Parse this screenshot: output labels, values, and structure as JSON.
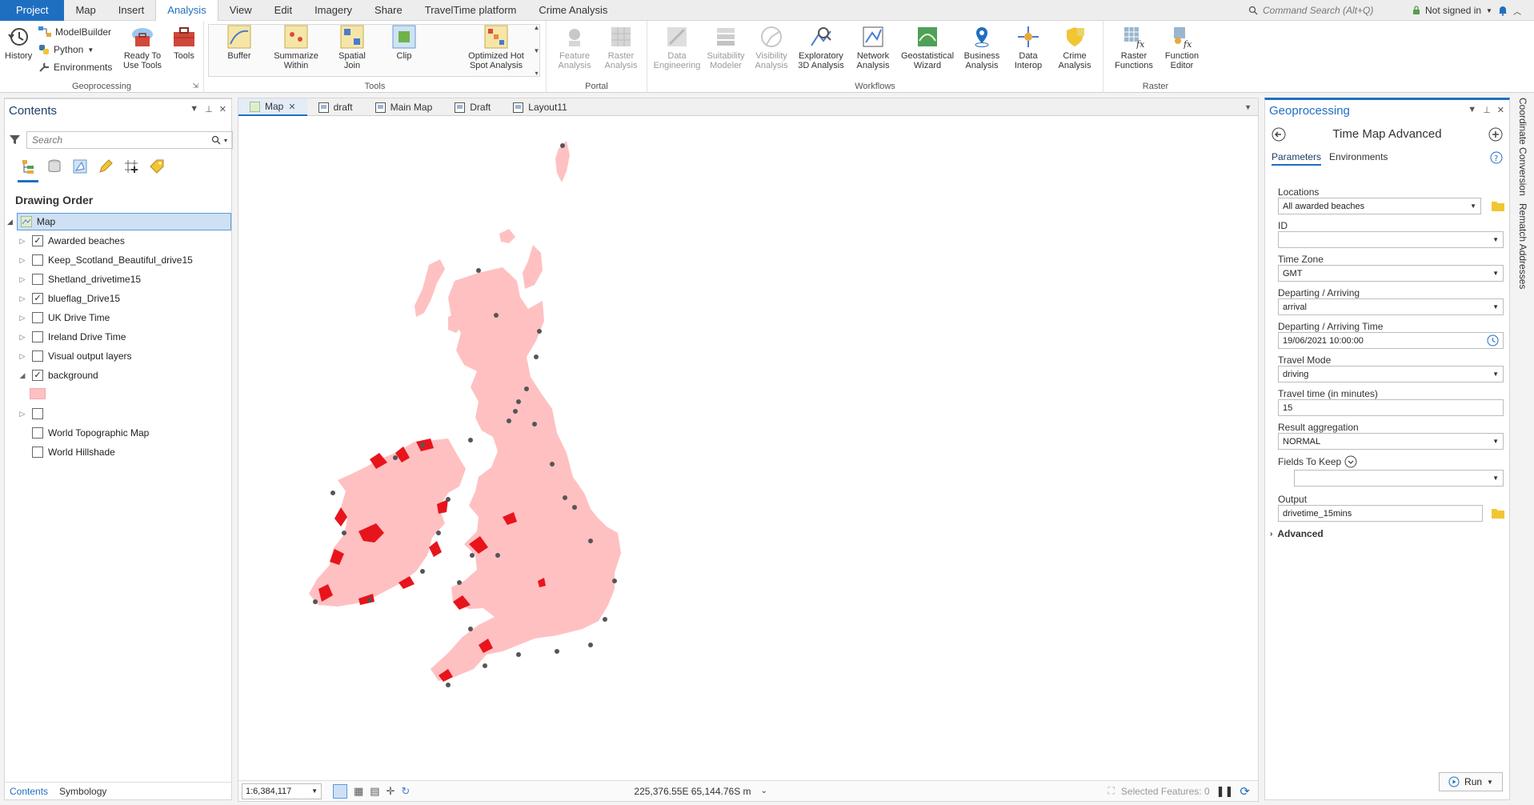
{
  "ribbon_tabs": [
    "Project",
    "Map",
    "Insert",
    "Analysis",
    "View",
    "Edit",
    "Imagery",
    "Share",
    "TravelTime platform",
    "Crime Analysis"
  ],
  "command_search": "Command Search (Alt+Q)",
  "signin": "Not signed in",
  "geoprocessing_group": {
    "title": "Geoprocessing",
    "history": "History",
    "modelbuilder": "ModelBuilder",
    "python": "Python",
    "environments": "Environments",
    "ready_to_use": "Ready To\nUse Tools",
    "tools": "Tools"
  },
  "tools_group": {
    "title": "Tools",
    "items": [
      "Buffer",
      "Summarize\nWithin",
      "Spatial\nJoin",
      "Clip",
      "Optimized Hot\nSpot Analysis"
    ]
  },
  "portal_group": {
    "title": "Portal",
    "items": [
      "Feature\nAnalysis",
      "Raster\nAnalysis"
    ]
  },
  "workflows_group": {
    "title": "Workflows",
    "items": [
      "Data\nEngineering",
      "Suitability\nModeler",
      "Visibility\nAnalysis",
      "Exploratory\n3D Analysis",
      "Network\nAnalysis",
      "Geostatistical\nWizard",
      "Business\nAnalysis",
      "Data\nInterop",
      "Crime\nAnalysis"
    ]
  },
  "raster_group": {
    "title": "Raster",
    "items": [
      "Raster\nFunctions",
      "Function\nEditor"
    ]
  },
  "contents": {
    "title": "Contents",
    "search_placeholder": "Search",
    "drawing_order": "Drawing Order",
    "map_label": "Map",
    "layers": [
      {
        "name": "Awarded beaches",
        "checked": "✓"
      },
      {
        "name": "Keep_Scotland_Beautiful_drive15",
        "checked": ""
      },
      {
        "name": "Shetland_drivetime15",
        "checked": ""
      },
      {
        "name": "blueflag_Drive15",
        "checked": "✓"
      },
      {
        "name": "UK Drive Time",
        "checked": ""
      },
      {
        "name": "Ireland Drive Time",
        "checked": ""
      },
      {
        "name": "Visual output layers",
        "checked": ""
      },
      {
        "name": "background",
        "checked": "✓"
      }
    ],
    "basemaps": [
      "World Topographic Map",
      "World Hillshade"
    ],
    "bottom_tabs": [
      "Contents",
      "Symbology"
    ]
  },
  "map_tabs": [
    "Map",
    "draft",
    "Main Map",
    "Draft",
    "Layout11"
  ],
  "status": {
    "scale": "1:6,384,117",
    "coords": "225,376.55E 65,144.76S m",
    "selected": "Selected Features: 0"
  },
  "geoprocessing": {
    "panel_title": "Geoprocessing",
    "tool_title": "Time Map Advanced",
    "tabs": [
      "Parameters",
      "Environments"
    ],
    "params": {
      "locations_label": "Locations",
      "locations_value": "All awarded beaches",
      "id_label": "ID",
      "id_value": "",
      "timezone_label": "Time Zone",
      "timezone_value": "GMT",
      "dep_arr_label": "Departing / Arriving",
      "dep_arr_value": "arrival",
      "dep_arr_time_label": "Departing / Arriving Time",
      "dep_arr_time_value": "19/06/2021 10:00:00",
      "travel_mode_label": "Travel Mode",
      "travel_mode_value": "driving",
      "travel_time_label": "Travel time (in minutes)",
      "travel_time_value": "15",
      "result_agg_label": "Result aggregation",
      "result_agg_value": "NORMAL",
      "fields_label": "Fields To Keep",
      "fields_value": "",
      "output_label": "Output",
      "output_value": "drivetime_15mins",
      "advanced_label": "Advanced"
    },
    "run_label": "Run"
  },
  "side_panels": [
    "Coordinate Conversion",
    "Rematch Addresses"
  ],
  "colors": {
    "accent": "#1f6fc1",
    "land": "#ffc0c2",
    "drivetime": "#e8141c"
  }
}
